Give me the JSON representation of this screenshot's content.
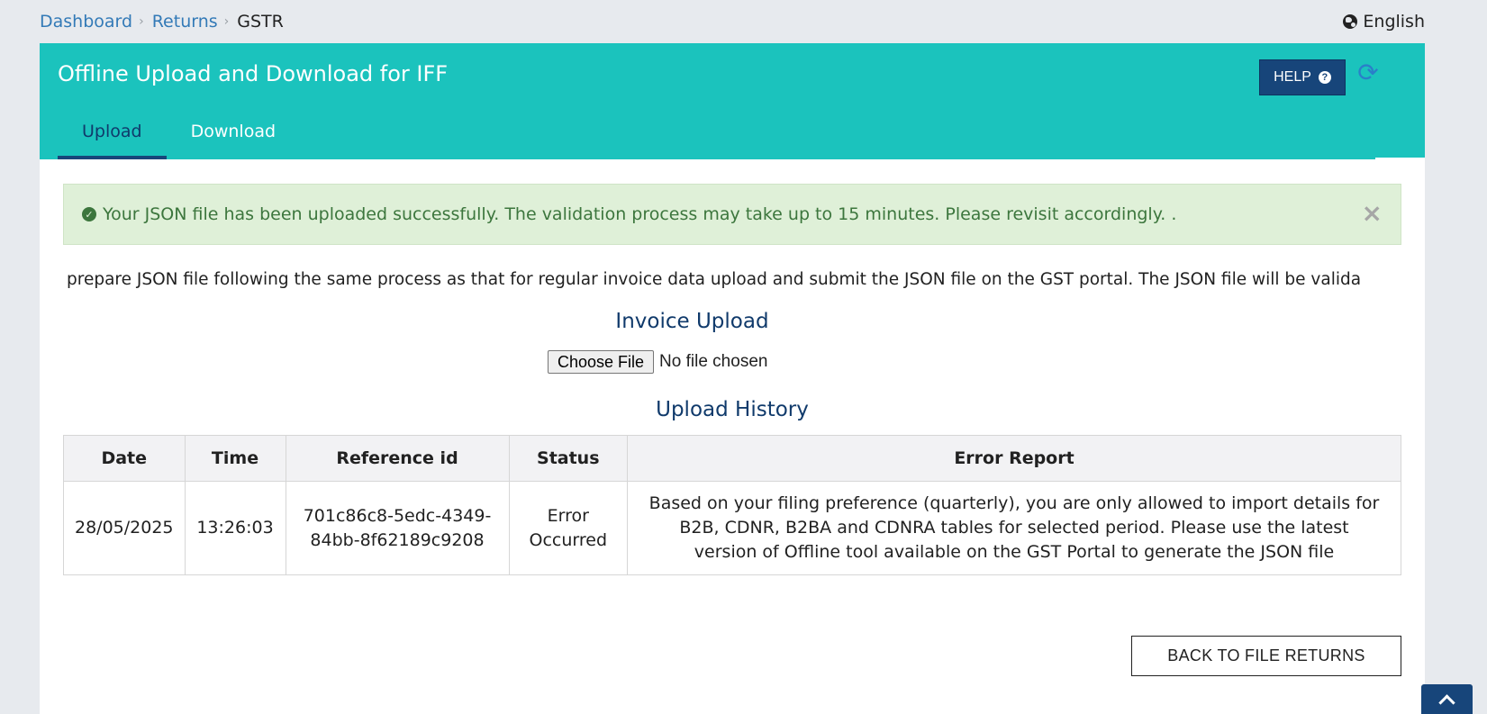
{
  "breadcrumb": {
    "items": [
      "Dashboard",
      "Returns"
    ],
    "current": "GSTR"
  },
  "language": "English",
  "page": {
    "title": "Offline Upload and Download for IFF",
    "help_label": "HELP",
    "tabs": [
      {
        "label": "Upload",
        "active": true
      },
      {
        "label": "Download",
        "active": false
      }
    ]
  },
  "alert": {
    "message": "Your JSON file has been uploaded successfully. The validation process may take up to 15 minutes. Please revisit accordingly. ."
  },
  "info_text": "prepare JSON file following the same process as that for regular invoice data upload and submit the JSON file on the GST portal. The JSON file will be valida",
  "upload": {
    "heading": "Invoice Upload",
    "button_label": "Choose File",
    "file_status": "No file chosen"
  },
  "history": {
    "heading": "Upload History",
    "columns": [
      "Date",
      "Time",
      "Reference id",
      "Status",
      "Error Report"
    ],
    "rows": [
      {
        "date": "28/05/2025",
        "time": "13:26:03",
        "reference_id": "701c86c8-5edc-4349-84bb-8f62189c9208",
        "status": "Error Occurred",
        "error_report": "Based on your filing preference (quarterly), you are only allowed to import details for B2B, CDNR, B2BA and CDNRA tables for selected period. Please use the latest version of Offline tool available on the GST Portal to generate the JSON file"
      }
    ]
  },
  "back_button_label": "BACK TO FILE RETURNS",
  "colors": {
    "header": "#1bc3bd",
    "primary": "#17457a",
    "success_bg": "#dff0d8",
    "success_text": "#3c763d",
    "link": "#337ab7"
  }
}
